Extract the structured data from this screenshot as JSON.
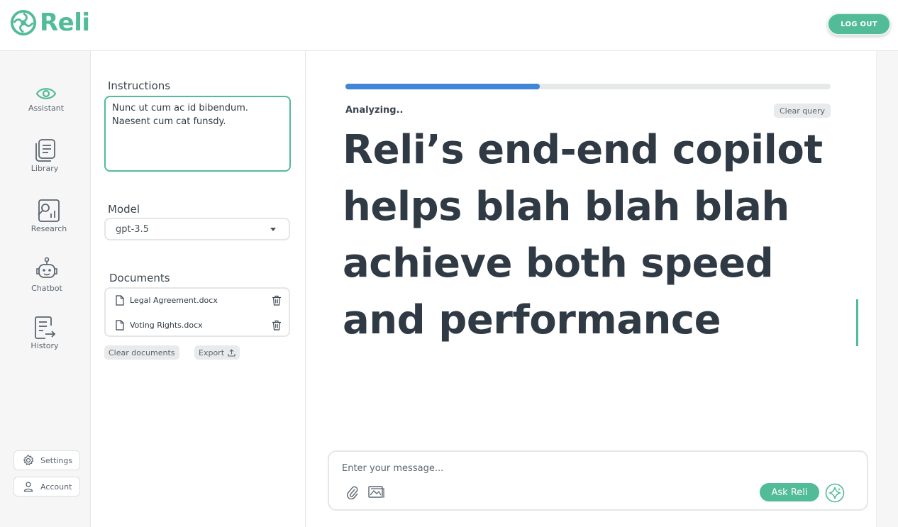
{
  "brand": {
    "name": "Reli",
    "accent": "#52bb97"
  },
  "header": {
    "logout_label": "LOG OUT"
  },
  "nav": {
    "items": [
      {
        "label": "Assistant",
        "icon": "eye-icon"
      },
      {
        "label": "Library",
        "icon": "library-icon"
      },
      {
        "label": "Research",
        "icon": "research-icon"
      },
      {
        "label": "Chatbot",
        "icon": "robot-icon"
      },
      {
        "label": "History",
        "icon": "history-icon"
      }
    ],
    "settings_label": "Settings",
    "account_label": "Account"
  },
  "panel": {
    "instructions_label": "Instructions",
    "instructions_text": "Nunc ut cum ac id bibendum.\nNaesent cum cat funsdy.",
    "model_label": "Model",
    "model_value": "gpt-3.5",
    "documents_label": "Documents",
    "documents": [
      {
        "name": "Legal Agreement.docx"
      },
      {
        "name": "Voting Rights.docx"
      }
    ],
    "clear_documents_label": "Clear documents",
    "export_label": "Export"
  },
  "main": {
    "progress": 0.4,
    "progress_color": "#3f86d9",
    "status_text": "Analyzing..",
    "clear_query_label": "Clear query",
    "headline": "Reli’s end-end copilot helps blah blah blah achieve both speed and performance",
    "composer": {
      "placeholder": "Enter your message...",
      "ask_label": "Ask Reli"
    }
  }
}
